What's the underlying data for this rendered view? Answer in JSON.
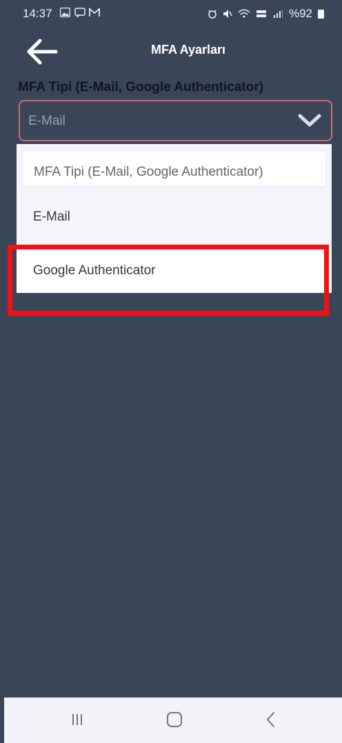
{
  "status_bar": {
    "time": "14:37",
    "left_icons": [
      "picture-icon",
      "message-icon",
      "gmail-icon"
    ],
    "right_icons": [
      "alarm-icon",
      "mute-icon",
      "wifi-icon",
      "volte-icon",
      "signal-icon"
    ],
    "battery": "%92"
  },
  "header": {
    "title": "MFA Ayarları"
  },
  "form": {
    "label": "MFA Tipi (E-Mail, Google Authenticator)",
    "selected_value": "E-Mail"
  },
  "dropdown": {
    "search_placeholder": "MFA Tipi (E-Mail, Google Authenticator)",
    "options": [
      {
        "label": "E-Mail"
      },
      {
        "label": "Google Authenticator"
      }
    ]
  },
  "colors": {
    "background": "#3a4657",
    "field_border": "#d56a72",
    "highlight": "#f41010",
    "dropdown": "#f4f5fa"
  }
}
